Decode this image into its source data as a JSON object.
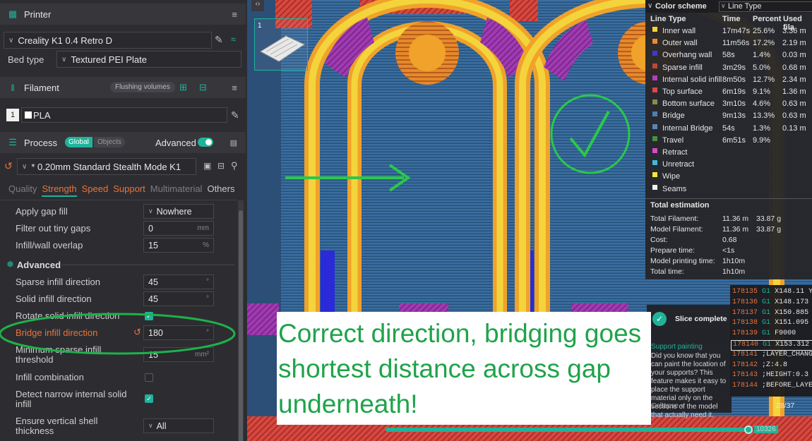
{
  "printer": {
    "section_title": "Printer",
    "name": "Creality K1 0.4 Retro D",
    "bed_type_label": "Bed type",
    "bed_type_value": "Textured PEI Plate"
  },
  "filament": {
    "section_title": "Filament",
    "flushing_label": "Flushing volumes",
    "slot_number": "1",
    "material": "PLA"
  },
  "process": {
    "section_title": "Process",
    "global_label": "Global",
    "objects_label": "Objects",
    "advanced_label": "Advanced",
    "preset": "* 0.20mm Standard Stealth Mode K1"
  },
  "tabs": [
    {
      "label": "Quality"
    },
    {
      "label": "Strength"
    },
    {
      "label": "Speed"
    },
    {
      "label": "Support"
    },
    {
      "label": "Multimaterial"
    },
    {
      "label": "Others"
    }
  ],
  "params": {
    "apply_gap_fill": {
      "label": "Apply gap fill",
      "value": "Nowhere"
    },
    "filter_tiny_gaps": {
      "label": "Filter out tiny gaps",
      "value": "0",
      "unit": "mm"
    },
    "infill_wall_overlap": {
      "label": "Infill/wall overlap",
      "value": "15",
      "unit": "%"
    },
    "advanced_title": "Advanced",
    "sparse_infill_direction": {
      "label": "Sparse infill direction",
      "value": "45",
      "unit": "°"
    },
    "solid_infill_direction": {
      "label": "Solid infill direction",
      "value": "45",
      "unit": "°"
    },
    "rotate_solid_infill": {
      "label": "Rotate solid infill direction"
    },
    "bridge_infill_direction": {
      "label": "Bridge infill direction",
      "value": "180",
      "unit": "°"
    },
    "min_sparse_infill": {
      "label": "Minimum sparse infill threshold",
      "value": "15",
      "unit": "mm²"
    },
    "infill_combination": {
      "label": "Infill combination"
    },
    "detect_narrow": {
      "label": "Detect narrow internal solid infill"
    },
    "ensure_vertical": {
      "label": "Ensure vertical shell thickness",
      "value": "All"
    }
  },
  "viewport": {
    "plate_number": "1"
  },
  "legend": {
    "color_scheme_label": "Color scheme",
    "color_scheme_value": "Line Type",
    "col_line_type": "Line Type",
    "col_time": "Time",
    "col_percent": "Percent",
    "col_used": "Used fila",
    "rows": [
      {
        "name": "Inner wall",
        "time": "17m47s",
        "percent": "25.6%",
        "used": "3.36 m",
        "color": "#f3d43c"
      },
      {
        "name": "Outer wall",
        "time": "11m56s",
        "percent": "17.2%",
        "used": "2.19 m",
        "color": "#ef8a2c"
      },
      {
        "name": "Overhang wall",
        "time": "58s",
        "percent": "1.4%",
        "used": "0.03 m",
        "color": "#3a3ad8"
      },
      {
        "name": "Sparse infill",
        "time": "3m29s",
        "percent": "5.0%",
        "used": "0.68 m",
        "color": "#b84a3a"
      },
      {
        "name": "Internal solid infill",
        "time": "8m50s",
        "percent": "12.7%",
        "used": "2.34 m",
        "color": "#b13fc2"
      },
      {
        "name": "Top surface",
        "time": "6m19s",
        "percent": "9.1%",
        "used": "1.36 m",
        "color": "#e34545"
      },
      {
        "name": "Bottom surface",
        "time": "3m10s",
        "percent": "4.6%",
        "used": "0.63 m",
        "color": "#8a8a52"
      },
      {
        "name": "Bridge",
        "time": "9m13s",
        "percent": "13.3%",
        "used": "0.63 m",
        "color": "#4d7fae"
      },
      {
        "name": "Internal Bridge",
        "time": "54s",
        "percent": "1.3%",
        "used": "0.13 m",
        "color": "#5a85b0"
      },
      {
        "name": "Travel",
        "time": "6m51s",
        "percent": "9.9%",
        "used": "",
        "color": "#4a8f3a"
      },
      {
        "name": "Retract",
        "time": "",
        "percent": "",
        "used": "",
        "color": "#d54ac8"
      },
      {
        "name": "Unretract",
        "time": "",
        "percent": "",
        "used": "",
        "color": "#43b7d9"
      },
      {
        "name": "Wipe",
        "time": "",
        "percent": "",
        "used": "",
        "color": "#f3e83c"
      },
      {
        "name": "Seams",
        "time": "",
        "percent": "",
        "used": "",
        "color": "#f0f0f0"
      }
    ],
    "estimation_title": "Total estimation",
    "estimation": [
      {
        "label": "Total Filament:",
        "value": "11.36 m",
        "extra": "33.87 g"
      },
      {
        "label": "Model Filament:",
        "value": "11.36 m",
        "extra": "33.87 g"
      },
      {
        "label": "Cost:",
        "value": "0.68",
        "extra": ""
      },
      {
        "label": "Prepare time:",
        "value": "<1s",
        "extra": ""
      },
      {
        "label": "Model printing time:",
        "value": "1h10m",
        "extra": ""
      },
      {
        "label": "Total time:",
        "value": "1h10m",
        "extra": ""
      }
    ]
  },
  "gcode": [
    {
      "ln": "178135",
      "op": "G1",
      "txt": "X148.11 Y1"
    },
    {
      "ln": "178136",
      "op": "G1",
      "txt": "X148.173 Y"
    },
    {
      "ln": "178137",
      "op": "G1",
      "txt": "X150.885 Y"
    },
    {
      "ln": "178138",
      "op": "G1",
      "txt": "X151.095 Y"
    },
    {
      "ln": "178139",
      "op": "G1",
      "txt": "F9000"
    },
    {
      "ln": "178140",
      "op": "G1",
      "txt": "X153.312 Y"
    },
    {
      "ln": "178141",
      "op": "",
      "txt": ";LAYER_CHANG"
    },
    {
      "ln": "178142",
      "op": "",
      "txt": ";Z:4.8"
    },
    {
      "ln": "178143",
      "op": "",
      "txt": ";HEIGHT:0.3"
    },
    {
      "ln": "178144",
      "op": "",
      "txt": ";BEFORE_LAYE"
    }
  ],
  "slice": {
    "title": "Slice complete",
    "tip_title": "Support painting",
    "tip_text": "Did you know that you can paint the location of your supports? This feature makes it easy to place the support material only on the sections of the model that actually need it.",
    "collapse": "Collapse",
    "page": "28/37"
  },
  "slider": {
    "value": "10326"
  },
  "annotation": {
    "text": "Correct direction, bridging goes shortest distance across gap underneath!"
  }
}
